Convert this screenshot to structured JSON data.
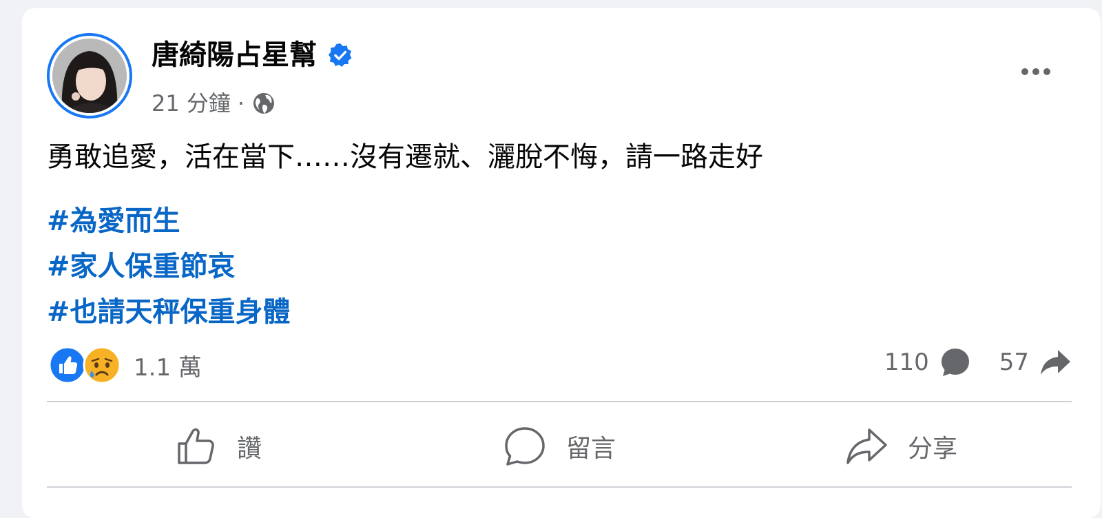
{
  "post": {
    "author": "唐綺陽占星幫",
    "time": "21 分鐘",
    "separator": "·",
    "text": "勇敢追愛，活在當下……沒有遷就、灑脫不悔，請一路走好",
    "hashtags": [
      "#為愛而生",
      "#家人保重節哀",
      "#也請天秤保重身體"
    ]
  },
  "engagement": {
    "reaction_count": "1.1 萬",
    "reaction_types": [
      "like-icon",
      "sad-icon"
    ],
    "comments": "110",
    "shares": "57"
  },
  "actions": {
    "like": "讚",
    "comment": "留言",
    "share": "分享"
  },
  "colors": {
    "accent": "#1877f2",
    "hashtag": "#0866c6",
    "secondary_text": "#65676b",
    "sad_face": "#f7b125"
  }
}
